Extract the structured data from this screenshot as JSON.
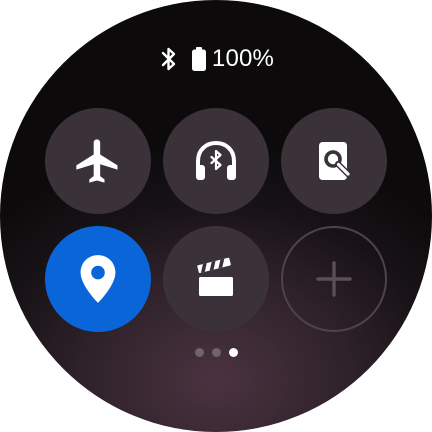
{
  "status_bar": {
    "bluetooth_icon": "bluetooth-icon",
    "battery_icon": "battery-full-icon",
    "battery_percent": "100%"
  },
  "tiles": [
    {
      "icon": "airplane-icon",
      "state": "off"
    },
    {
      "icon": "bluetooth-headphones-icon",
      "state": "off"
    },
    {
      "icon": "find-device-icon",
      "state": "off"
    },
    {
      "icon": "location-pin-icon",
      "state": "on"
    },
    {
      "icon": "clapperboard-icon",
      "state": "off"
    },
    {
      "icon": "plus-icon",
      "state": "add"
    }
  ],
  "pager": {
    "count": 3,
    "active_index": 2
  },
  "colors": {
    "active_tile": "#0a66d8",
    "inactive_tile": "#3a3238",
    "icon": "#ffffff"
  }
}
